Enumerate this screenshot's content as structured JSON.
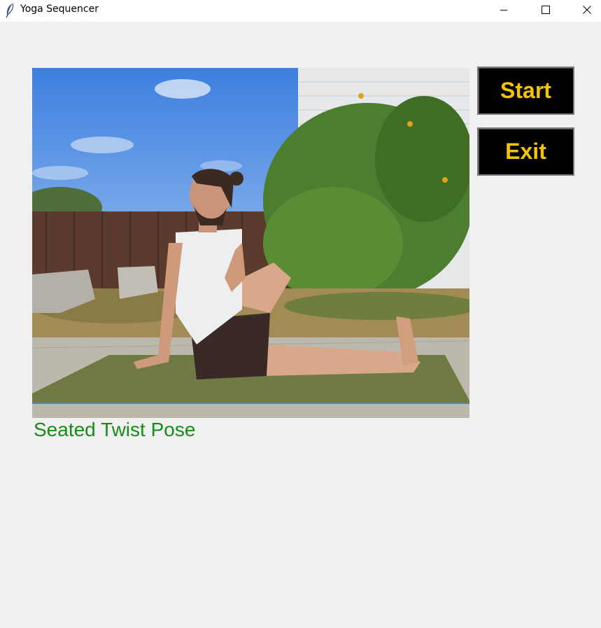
{
  "window": {
    "title": "Yoga Sequencer",
    "app_icon": "feather-icon",
    "controls": {
      "minimize_icon": "minimize-icon",
      "maximize_icon": "maximize-icon",
      "close_icon": "close-icon"
    }
  },
  "pose": {
    "name": "Seated Twist Pose",
    "name_color": "#1a8a1a"
  },
  "buttons": {
    "start_label": "Start",
    "exit_label": "Exit",
    "background": "#000000",
    "text_color": "#f5c400"
  },
  "colors": {
    "window_background": "#f0f0f0",
    "titlebar_background": "#ffffff"
  }
}
